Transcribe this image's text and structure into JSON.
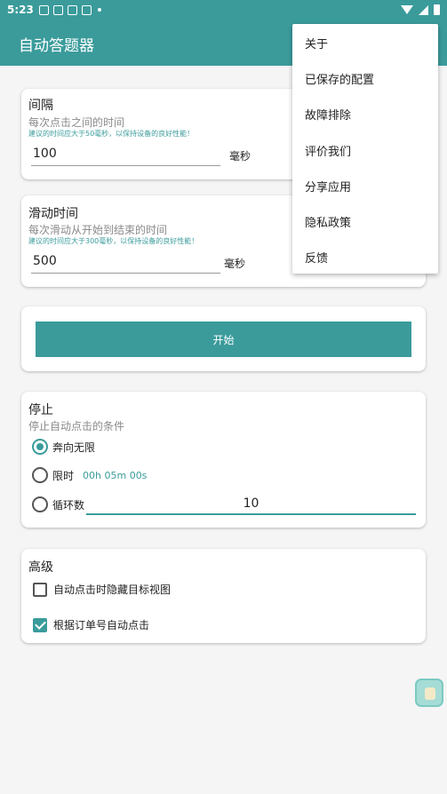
{
  "status_bar": {
    "time": "5:23"
  },
  "app": {
    "title": "自动答题器"
  },
  "interval_card": {
    "title": "间隔",
    "subtitle": "每次点击之间的时间",
    "hint": "建议的时间应大于50毫秒，以保持设备的良好性能！",
    "value": "100",
    "unit": "毫秒"
  },
  "swipe_card": {
    "title": "滑动时间",
    "subtitle": "每次滑动从开始到结束的时间",
    "hint": "建议的时间应大于300毫秒，以保持设备的良好性能！",
    "value": "500",
    "unit": "毫秒"
  },
  "start_button": {
    "label": "开始"
  },
  "stop_card": {
    "title": "停止",
    "subtitle": "停止自动点击的条件",
    "options": [
      {
        "label": "奔向无限",
        "selected": true
      },
      {
        "label": "限时",
        "value": "00h 05m 00s",
        "selected": false
      },
      {
        "label": "循环数",
        "value": "10",
        "selected": false
      }
    ]
  },
  "advanced_card": {
    "title": "高级",
    "options": [
      {
        "label": "自动点击时隐藏目标视图",
        "checked": false
      },
      {
        "label": "根据订单号自动点击",
        "checked": true
      }
    ]
  },
  "menu": {
    "items": [
      "关于",
      "已保存的配置",
      "故障排除",
      "评价我们",
      "分享应用",
      "隐私政策",
      "反馈"
    ]
  },
  "colors": {
    "accent": "#3b9b9b"
  }
}
